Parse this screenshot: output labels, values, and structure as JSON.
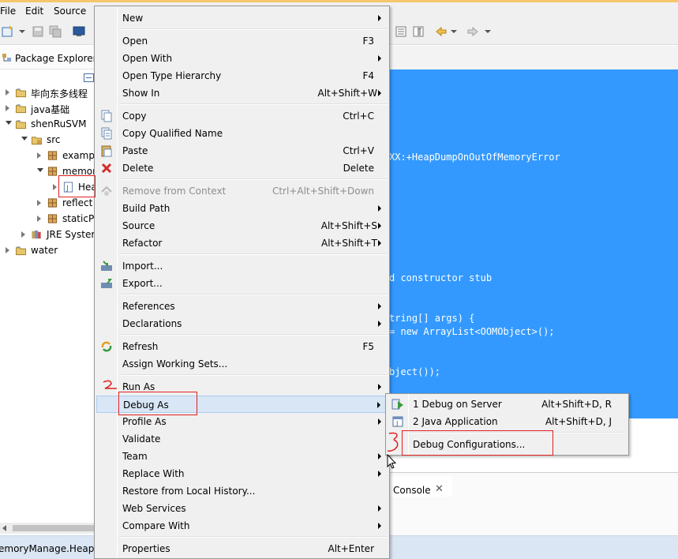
{
  "menubar": {
    "file": "File",
    "edit": "Edit",
    "source": "Source"
  },
  "explorer": {
    "title": "Package Explorer",
    "tree": [
      {
        "label": "毕向东多线程",
        "expanded": false,
        "icon": "project-folder-icon"
      },
      {
        "label": "java基础",
        "expanded": false,
        "icon": "project-folder-icon"
      },
      {
        "label": "shenRuSVM",
        "expanded": true,
        "icon": "project-folder-icon"
      },
      {
        "label": "src",
        "expanded": true,
        "icon": "source-folder-icon"
      },
      {
        "label": "examp",
        "expanded": false,
        "icon": "package-icon"
      },
      {
        "label": "memor",
        "expanded": true,
        "icon": "package-icon"
      },
      {
        "label": "Hea",
        "expanded": false,
        "icon": "java-file-icon"
      },
      {
        "label": "reflect",
        "expanded": false,
        "icon": "package-icon"
      },
      {
        "label": "staticPr",
        "expanded": false,
        "icon": "package-icon"
      },
      {
        "label": "JRE Syster",
        "expanded": false,
        "icon": "library-icon"
      },
      {
        "label": "water",
        "expanded": false,
        "icon": "project-folder-icon"
      }
    ]
  },
  "editor": {
    "code_lines": [
      "XX:+HeapDumpOnOutOfMemoryError",
      "d constructor stub",
      "tring[] args) {",
      "= new ArrayList<OOMObject>();",
      "bject());"
    ]
  },
  "console": {
    "tab_label": "Console"
  },
  "status_bar": {
    "text": "emoryManage.Heap"
  },
  "context_menu": {
    "items": [
      {
        "label": "New",
        "shortcut": "",
        "submenu": true
      },
      {
        "label": "Open",
        "shortcut": "F3",
        "submenu": false
      },
      {
        "label": "Open With",
        "shortcut": "",
        "submenu": true
      },
      {
        "label": "Open Type Hierarchy",
        "shortcut": "F4",
        "submenu": false
      },
      {
        "label": "Show In",
        "shortcut": "Alt+Shift+W",
        "submenu": true
      },
      {
        "label": "Copy",
        "shortcut": "Ctrl+C",
        "submenu": false,
        "icon": "copy-icon"
      },
      {
        "label": "Copy Qualified Name",
        "shortcut": "",
        "submenu": false,
        "icon": "copy-qualified-icon"
      },
      {
        "label": "Paste",
        "shortcut": "Ctrl+V",
        "submenu": false,
        "icon": "paste-icon"
      },
      {
        "label": "Delete",
        "shortcut": "Delete",
        "submenu": false,
        "icon": "delete-icon"
      },
      {
        "label": "Remove from Context",
        "shortcut": "Ctrl+Alt+Shift+Down",
        "submenu": false,
        "disabled": true,
        "icon": "remove-context-icon"
      },
      {
        "label": "Build Path",
        "shortcut": "",
        "submenu": true
      },
      {
        "label": "Source",
        "shortcut": "Alt+Shift+S",
        "submenu": true
      },
      {
        "label": "Refactor",
        "shortcut": "Alt+Shift+T",
        "submenu": true
      },
      {
        "label": "Import...",
        "shortcut": "",
        "submenu": false,
        "icon": "import-icon"
      },
      {
        "label": "Export...",
        "shortcut": "",
        "submenu": false,
        "icon": "export-icon"
      },
      {
        "label": "References",
        "shortcut": "",
        "submenu": true
      },
      {
        "label": "Declarations",
        "shortcut": "",
        "submenu": true
      },
      {
        "label": "Refresh",
        "shortcut": "F5",
        "submenu": false,
        "icon": "refresh-icon"
      },
      {
        "label": "Assign Working Sets...",
        "shortcut": "",
        "submenu": false
      },
      {
        "label": "Run As",
        "shortcut": "",
        "submenu": true
      },
      {
        "label": "Debug As",
        "shortcut": "",
        "submenu": true,
        "highlighted": true
      },
      {
        "label": "Profile As",
        "shortcut": "",
        "submenu": true
      },
      {
        "label": "Validate",
        "shortcut": "",
        "submenu": false
      },
      {
        "label": "Team",
        "shortcut": "",
        "submenu": true
      },
      {
        "label": "Replace With",
        "shortcut": "",
        "submenu": true
      },
      {
        "label": "Restore from Local History...",
        "shortcut": "",
        "submenu": false
      },
      {
        "label": "Web Services",
        "shortcut": "",
        "submenu": true
      },
      {
        "label": "Compare With",
        "shortcut": "",
        "submenu": true
      },
      {
        "label": "Properties",
        "shortcut": "Alt+Enter",
        "submenu": false
      }
    ]
  },
  "submenu": {
    "items": [
      {
        "label": "1 Debug on Server",
        "shortcut": "Alt+Shift+D, R",
        "icon": "debug-server-icon"
      },
      {
        "label": "2 Java Application",
        "shortcut": "Alt+Shift+D, J",
        "icon": "java-app-icon"
      },
      {
        "label": "Debug Configurations...",
        "shortcut": ""
      }
    ]
  },
  "colors": {
    "editor_selection": "#3399ff",
    "menu_background": "#f0f0f0",
    "menu_highlight": "#d8e6f5",
    "annotation": "#e02020",
    "statusbar": "#dbe6f4"
  }
}
